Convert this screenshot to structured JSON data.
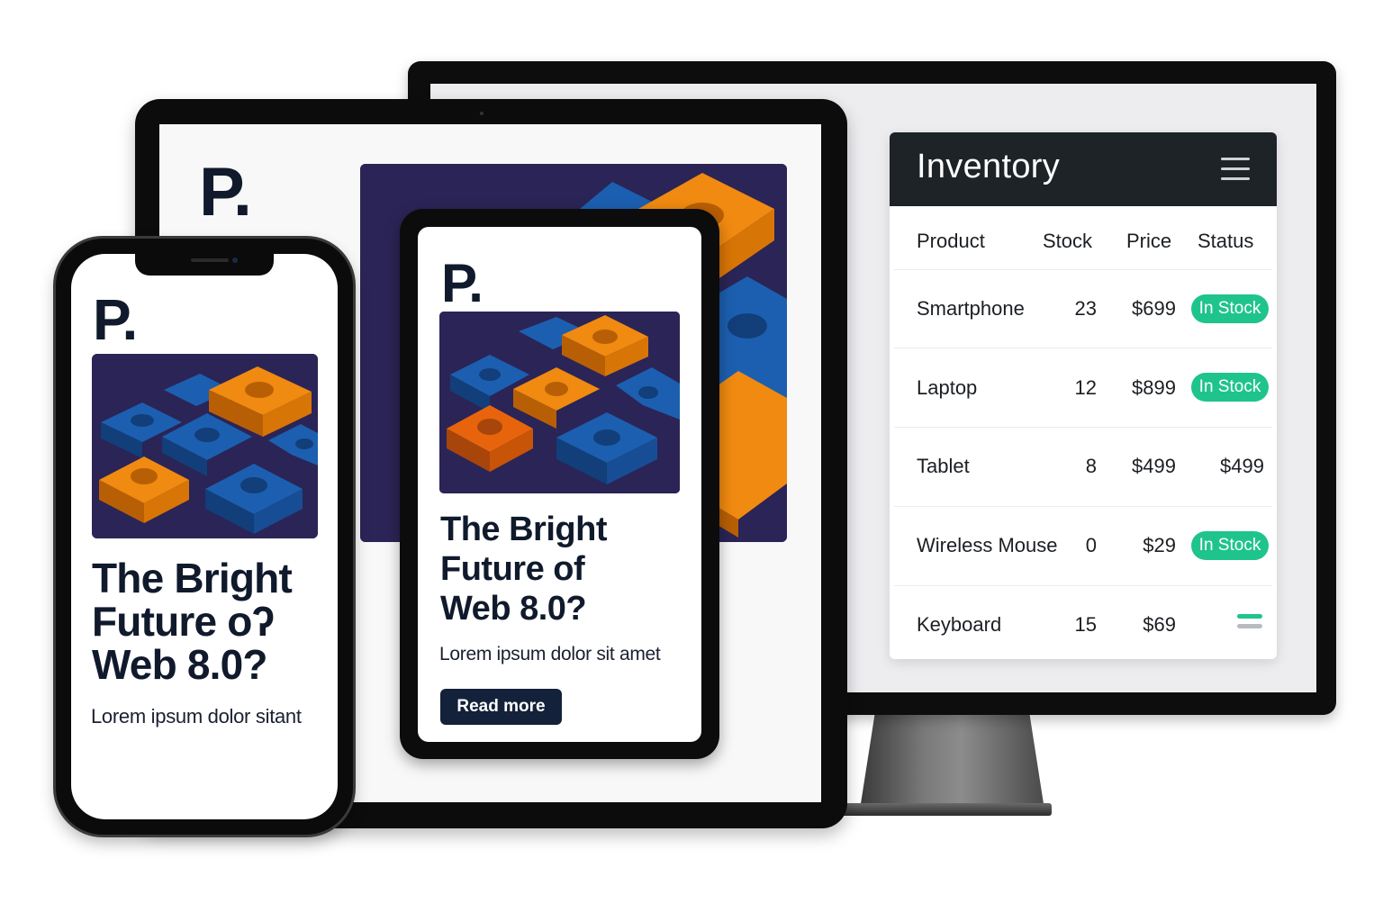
{
  "brand": {
    "logo": "P."
  },
  "article": {
    "headline_line1": "The Bright",
    "mini_headline_line2": "Future of",
    "phone_headline_line2": "Future oʔ",
    "headline_line3": "Web 8.0?",
    "mini_lorem": "Lorem ipsum dolor sit amet",
    "phone_lorem": "Lorem ipsum dolor sitant",
    "read_more_label": "Read more"
  },
  "inventory": {
    "title": "Inventory",
    "menu_icon": "hamburger-menu-icon",
    "columns": [
      "Product",
      "Stock",
      "Price",
      "Status"
    ],
    "rows": [
      {
        "product": "Smartphone",
        "stock": "23",
        "price": "$699",
        "status": "In Stock",
        "status_type": "badge"
      },
      {
        "product": "Laptop",
        "stock": "12",
        "price": "$899",
        "status": "In Stock",
        "status_type": "badge"
      },
      {
        "product": "Tablet",
        "stock": "8",
        "price": "$499",
        "status": "$499",
        "status_type": "text"
      },
      {
        "product": "Wireless Mouse",
        "stock": "0",
        "price": "$29",
        "status": "In Stock",
        "status_type": "badge"
      },
      {
        "product": "Keyboard",
        "stock": "15",
        "price": "$69",
        "status": "",
        "status_type": "bars"
      }
    ]
  },
  "colors": {
    "navy": "#101a2c",
    "header_dark": "#1e2328",
    "badge_green": "#1fc48c",
    "hero_bg": "#2b2456",
    "block_blue": "#1c5fb0",
    "block_orange": "#f08a10"
  }
}
